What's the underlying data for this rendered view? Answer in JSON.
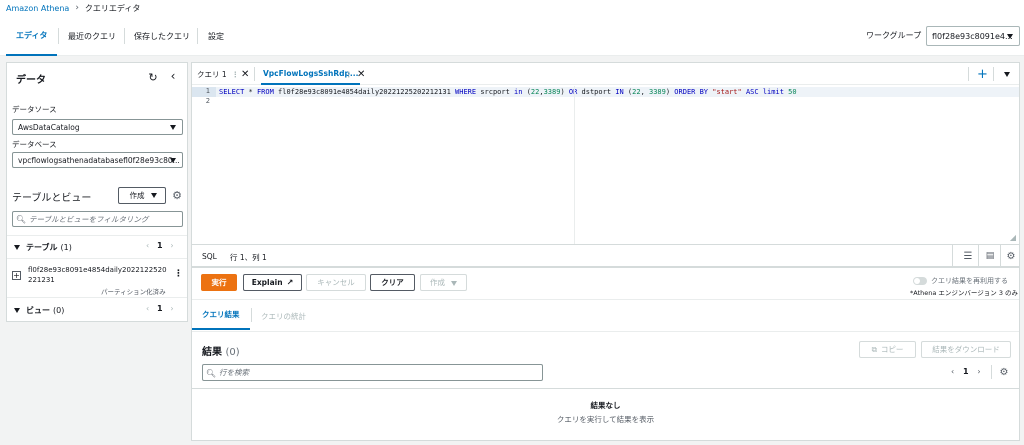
{
  "breadcrumb": {
    "service": "Amazon Athena",
    "current": "クエリエディタ"
  },
  "tabs": [
    "エディタ",
    "最近のクエリ",
    "保存したクエリ",
    "設定"
  ],
  "workgroup": {
    "label": "ワークグループ",
    "value": "fl0f28e93c8091e4..."
  },
  "data_panel": {
    "title": "データ",
    "datasource_label": "データソース",
    "datasource_value": "AwsDataCatalog",
    "database_label": "データベース",
    "database_value": "vpcflowlogsathenadatabasefl0f28e93c80...",
    "tables_views_title": "テーブルとビュー",
    "create_label": "作成",
    "filter_placeholder": "テーブルとビューをフィルタリング",
    "tables_label": "テーブル",
    "tables_count": "(1)",
    "tables_page": "1",
    "table_name_line1": "fl0f28e93c8091e4854daily2022122520",
    "table_name_line2": "221231",
    "partition_label": "パーティション化済み",
    "views_label": "ビュー",
    "views_count": "(0)",
    "views_page": "1"
  },
  "editor": {
    "tab1": "クエリ 1",
    "tab2": "VpcFlowLogsSshRdp...",
    "line1": "1",
    "line2": "2",
    "code": {
      "p1": "SELECT",
      "p2": " * ",
      "p3": "FROM",
      "p4": " fl0f28e93c8091e4854daily20221225202212131 ",
      "p5": "WHERE",
      "p6": " srcport ",
      "p7": "in",
      "p8": " (",
      "p9": "22",
      "p10": ",",
      "p11": "3389",
      "p12": ") ",
      "p13": "OR",
      "p14": " dstport ",
      "p15": "IN",
      "p16": " (",
      "p17": "22",
      "p18": ", ",
      "p19": "3389",
      "p20": ") ",
      "p21": "ORDER BY",
      "p22": " ",
      "p23": "\"start\"",
      "p24": " ",
      "p25": "ASC",
      "p26": " ",
      "p27": "limit",
      "p28": " ",
      "p29": "50"
    }
  },
  "status": {
    "lang": "SQL",
    "position": "行 1、列 1"
  },
  "actions": {
    "run": "実行",
    "explain": "Explain",
    "cancel": "キャンセル",
    "clear": "クリア",
    "create": "作成",
    "reuse_label": "クエリ結果を再利用する",
    "reuse_note": "*Athena エンジンバージョン 3 のみ"
  },
  "result_tabs": [
    "クエリ結果",
    "クエリの統計"
  ],
  "results": {
    "title": "結果",
    "count": "(0)",
    "copy": "コピー",
    "download": "結果をダウンロード",
    "search_placeholder": "行を検索",
    "page": "1",
    "empty_title": "結果なし",
    "empty_sub": "クエリを実行して結果を表示"
  },
  "colors": {
    "accent": "#0073bb",
    "run": "#ec7211"
  }
}
